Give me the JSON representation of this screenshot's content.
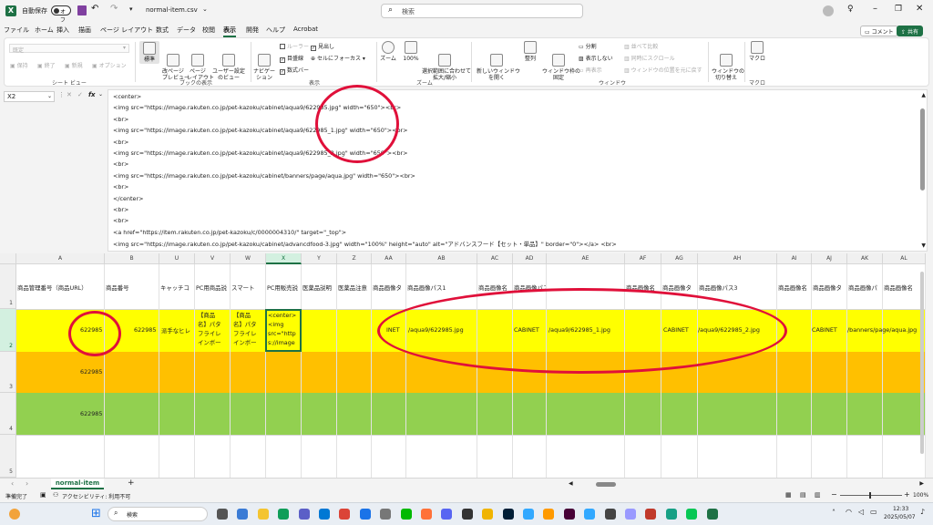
{
  "titlebar": {
    "autosave_label": "自動保存",
    "autosave_state": "オフ",
    "filename": "normal-item.csv",
    "search_placeholder": "検索"
  },
  "menu": {
    "tabs": [
      "ファイル",
      "ホーム",
      "挿入",
      "描画",
      "ページ レイアウト",
      "数式",
      "データ",
      "校閲",
      "表示",
      "開発",
      "ヘルプ",
      "Acrobat"
    ],
    "active": "表示",
    "comment_btn": "コメント",
    "share_btn": "共有"
  },
  "ribbon": {
    "sheetview": {
      "items": [
        "既定",
        "保持",
        "終了",
        "新規",
        "オプション"
      ],
      "label": "シート ビュー"
    },
    "bookview": {
      "items": [
        "標準",
        "改ページ\nプレビュー",
        "ページ\nレイアウト",
        "ユーザー設定\nのビュー"
      ],
      "label": "ブックの表示"
    },
    "show": {
      "nav": "ナビゲー\nション",
      "checks": [
        {
          "text": "ルーラー",
          "checked": false,
          "dim": true
        },
        {
          "text": "目盛線",
          "checked": true,
          "dim": false
        },
        {
          "text": "数式バー",
          "checked": true,
          "dim": false
        },
        {
          "text": "見出し",
          "checked": true,
          "dim": false
        },
        {
          "text": "セルにフォーカス",
          "checked": false,
          "dim": false
        }
      ],
      "label": "表示"
    },
    "zoom": {
      "items": [
        "ズーム",
        "100%",
        "選択範囲に合わせて\n拡大/縮小"
      ],
      "label": "ズーム"
    },
    "window": {
      "items": [
        "新しいウィンドウ\nを開く",
        "整列",
        "ウィンドウ枠の\n固定"
      ],
      "small": [
        {
          "text": "分割",
          "dim": false
        },
        {
          "text": "表示しない",
          "dim": false
        },
        {
          "text": "再表示",
          "dim": true
        },
        {
          "text": "並べて比較",
          "dim": true
        },
        {
          "text": "同時にスクロール",
          "dim": true
        },
        {
          "text": "ウィンドウの位置を元に戻す",
          "dim": true
        }
      ],
      "switch": "ウィンドウの\n切り替え",
      "label": "ウィンドウ"
    },
    "macro": {
      "item": "マクロ",
      "label": "マクロ"
    }
  },
  "formula": {
    "namebox": "X2",
    "fx": "fx",
    "lines": [
      "<center>",
      "<img src=\"https://image.rakuten.co.jp/pet-kazoku/cabinet/aqua9/622985.jpg\" width=\"650\"><br>",
      "<br>",
      "<img src=\"https://image.rakuten.co.jp/pet-kazoku/cabinet/aqua9/622985_1.jpg\" width=\"650\"><br>",
      "<br>",
      "<img src=\"https://image.rakuten.co.jp/pet-kazoku/cabinet/aqua9/622985_2.jpg\" width=\"650\"><br>",
      "<br>",
      "<img src=\"https://image.rakuten.co.jp/pet-kazoku/cabinet/banners/page/aqua.jpg\" width=\"650\"><br>",
      "<br>",
      "</center>",
      "<br>",
      "<br>",
      "<a href=\"https://item.rakuten.co.jp/pet-kazoku/c/0000004310/\" target=\"_top\">",
      "<img src=\"https://image.rakuten.co.jp/pet-kazoku/cabinet/advancdfood-3.jpg\" width=\"100%\" height=\"auto\" alt=\"アドバンスフード【セット・単品】\" border=\"0\"></a> <br>"
    ]
  },
  "grid": {
    "columns": [
      "A",
      "B",
      "U",
      "V",
      "W",
      "X",
      "Y",
      "Z",
      "AA",
      "AB",
      "AC",
      "AD",
      "AE",
      "AF",
      "AG",
      "AH",
      "AI",
      "AJ",
      "AK",
      "AL"
    ],
    "headers": [
      "商品管理番号（商品URL）",
      "商品番号",
      "キャッチコ",
      "PC用商品説",
      "スマート",
      "PC用販売説",
      "医薬品説明",
      "医薬品注意",
      "商品画像タ",
      "商品画像パス1",
      "商品画像名",
      "商品画像パス2",
      "",
      "商品画像名",
      "商品画像タ",
      "商品画像パス3",
      "商品画像名",
      "商品画像タ",
      "商品画像パ",
      "商品画像名"
    ],
    "rows": [
      "1",
      "2",
      "3",
      "4",
      "5"
    ],
    "r2": {
      "a": "622985",
      "b": "622985",
      "u": "派手なヒレ",
      "v": [
        "【商品",
        "名】パタ",
        "フライレ",
        "インボー"
      ],
      "w": [
        "【商品",
        "名】パタ",
        "フライレ",
        "インボー"
      ],
      "x": [
        "<center>",
        "<img",
        "src=\"http",
        "s://image"
      ],
      "aa": "INET",
      "ab": "/aqua9/622985.jpg",
      "ad_pre": "CABINET",
      "ad": "/aqua9/622985_1.jpg",
      "ag_pre": "CABINET",
      "ag": "/aqua9/622985_2.jpg",
      "aj_pre": "CABINET",
      "aj": "/banners/page/aqua.jpg"
    },
    "r3": {
      "a": "622985"
    },
    "r4": {
      "a": "622985"
    },
    "colors": {
      "row2": "#ffff00",
      "row3": "#ffc000",
      "row4": "#92d050"
    }
  },
  "sheetbar": {
    "tab": "normal-item",
    "add": "+"
  },
  "status": {
    "ready": "準備完了",
    "accessibility": "アクセシビリティ: 利用不可",
    "zoom": "100%"
  },
  "taskbar": {
    "search": "検索",
    "time": "12:33",
    "date": "2025/05/07"
  }
}
